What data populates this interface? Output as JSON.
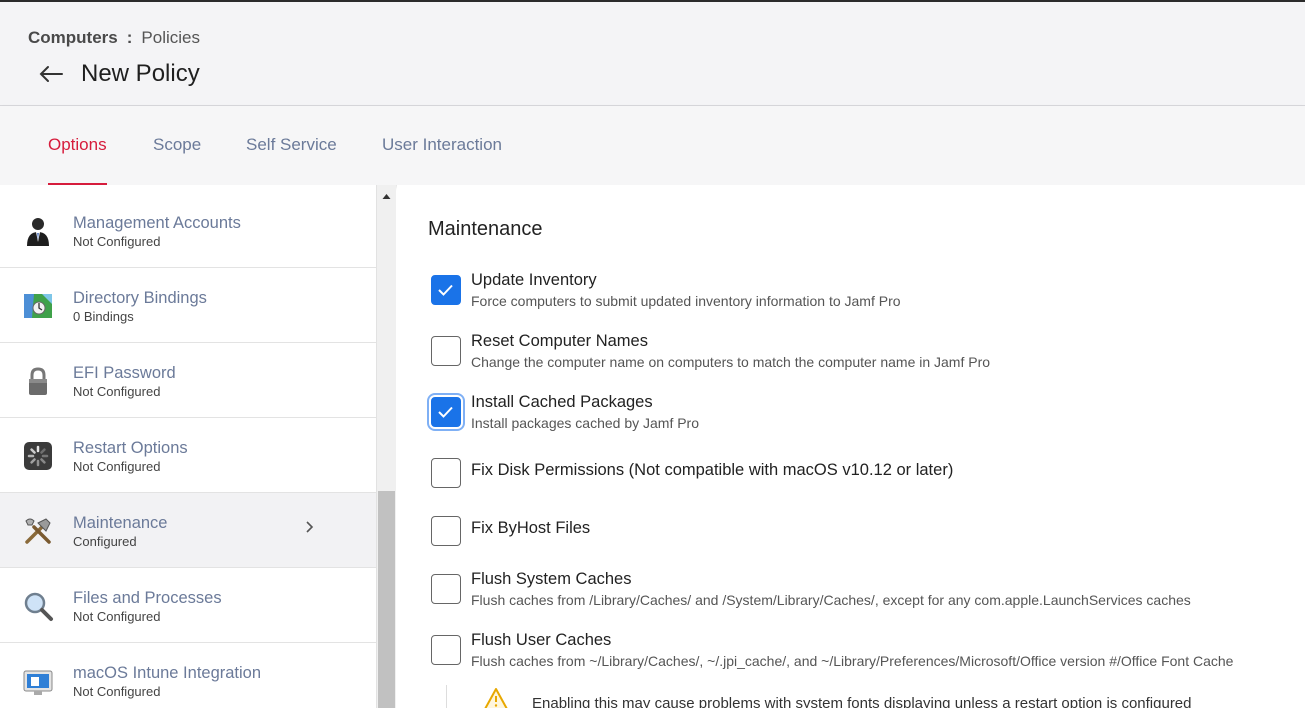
{
  "header": {
    "breadcrumb_root": "Computers",
    "breadcrumb_sep": ":",
    "breadcrumb_current": "Policies",
    "title": "New Policy"
  },
  "tabs": [
    {
      "label": "Options",
      "active": true
    },
    {
      "label": "Scope",
      "active": false
    },
    {
      "label": "Self Service",
      "active": false
    },
    {
      "label": "User Interaction",
      "active": false
    }
  ],
  "sidebar": {
    "items": [
      {
        "title": "Management Accounts",
        "subtitle": "Not Configured",
        "icon": "user-account-icon"
      },
      {
        "title": "Directory Bindings",
        "subtitle": "0 Bindings",
        "icon": "directory-map-icon"
      },
      {
        "title": "EFI Password",
        "subtitle": "Not Configured",
        "icon": "lock-icon"
      },
      {
        "title": "Restart Options",
        "subtitle": "Not Configured",
        "icon": "restart-spinner-icon"
      },
      {
        "title": "Maintenance",
        "subtitle": "Configured",
        "icon": "tools-icon",
        "selected": true
      },
      {
        "title": "Files and Processes",
        "subtitle": "Not Configured",
        "icon": "magnifier-icon"
      },
      {
        "title": "macOS Intune Integration",
        "subtitle": "Not Configured",
        "icon": "intune-computer-icon"
      }
    ]
  },
  "main": {
    "section_title": "Maintenance",
    "options": [
      {
        "label": "Update Inventory",
        "desc": "Force computers to submit updated inventory information to Jamf Pro",
        "checked": true
      },
      {
        "label": "Reset Computer Names",
        "desc": "Change the computer name on computers to match the computer name in Jamf Pro",
        "checked": false
      },
      {
        "label": "Install Cached Packages",
        "desc": "Install packages cached by Jamf Pro",
        "checked": true
      },
      {
        "label": "Fix Disk Permissions (Not compatible with macOS v10.12 or later)",
        "desc": "",
        "checked": false
      },
      {
        "label": "Fix ByHost Files",
        "desc": "",
        "checked": false
      },
      {
        "label": "Flush System Caches",
        "desc": "Flush caches from /Library/Caches/ and /System/Library/Caches/, except for any com.apple.LaunchServices caches",
        "checked": false
      },
      {
        "label": "Flush User Caches",
        "desc": "Flush caches from ~/Library/Caches/, ~/.jpi_cache/, and ~/Library/Preferences/Microsoft/Office version #/Office Font Cache",
        "checked": false
      }
    ],
    "warning": "Enabling this may cause problems with system fonts displaying unless a restart option is configured"
  },
  "colors": {
    "accent": "#d61c3c",
    "link": "#6b7a99",
    "checkbox_checked": "#1a73e8"
  }
}
